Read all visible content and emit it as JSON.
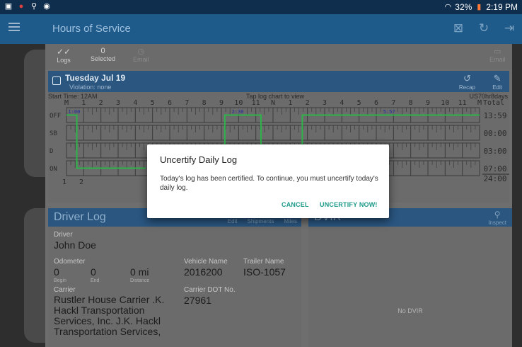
{
  "status_bar": {
    "battery": "32%",
    "time": "2:19 PM"
  },
  "app_bar": {
    "title": "Hours of Service"
  },
  "toolbar": {
    "logs_label": "Logs",
    "selected_count": "0",
    "selected_label": "Selected",
    "email_label": "Email",
    "email_right_label": "Email"
  },
  "day": {
    "date": "Tuesday Jul 19",
    "violation": "Violation: none",
    "recap_label": "Recap",
    "edit_label": "Edit"
  },
  "grid": {
    "start_time": "Start Time: 12AM",
    "hint": "Tap log chart to view",
    "rule": "US70hr8days",
    "hours": [
      "M",
      "1",
      "2",
      "3",
      "4",
      "5",
      "6",
      "7",
      "8",
      "9",
      "10",
      "11",
      "N",
      "1",
      "2",
      "3",
      "4",
      "5",
      "6",
      "7",
      "8",
      "9",
      "10",
      "11",
      "M"
    ],
    "total_label": "Total",
    "rows": [
      "OFF",
      "SB",
      "D",
      "ON"
    ],
    "totals": [
      "13:59",
      "00:00",
      "03:00",
      "07:00"
    ],
    "grand_total": "24:00",
    "markers": [
      "1:00",
      "2:30",
      "5:57"
    ],
    "bottom_left": [
      "1",
      "2"
    ]
  },
  "driver_log": {
    "title": "Driver Log",
    "tabs": [
      "Edit",
      "Shipments",
      "Miles"
    ],
    "driver_label": "Driver",
    "driver": "John Doe",
    "odometer_label": "Odometer",
    "odo_begin": "0",
    "odo_end": "0",
    "odo_distance": "0 mi",
    "begin_label": "Begin",
    "end_label": "End",
    "distance_label": "Distance",
    "vehicle_label": "Vehicle Name",
    "vehicle": "2016200",
    "trailer_label": "Trailer Name",
    "trailer": "ISO-1057",
    "carrier_label": "Carrier",
    "carrier": [
      "Rustler House Carrier .K.",
      "Hackl Transportation",
      "Services, Inc. J.K. Hackl",
      "Transportation Services,"
    ],
    "dot_label": "Carrier DOT No.",
    "dot": "27961"
  },
  "dvir": {
    "title": "DVIR",
    "inspect_label": "Inspect",
    "empty": "No DVIR"
  },
  "dialog": {
    "title": "Uncertify Daily Log",
    "body": "Today's log has been certified. To continue, you must uncertify today's daily log.",
    "cancel": "CANCEL",
    "confirm": "UNCERTIFY NOW!"
  }
}
